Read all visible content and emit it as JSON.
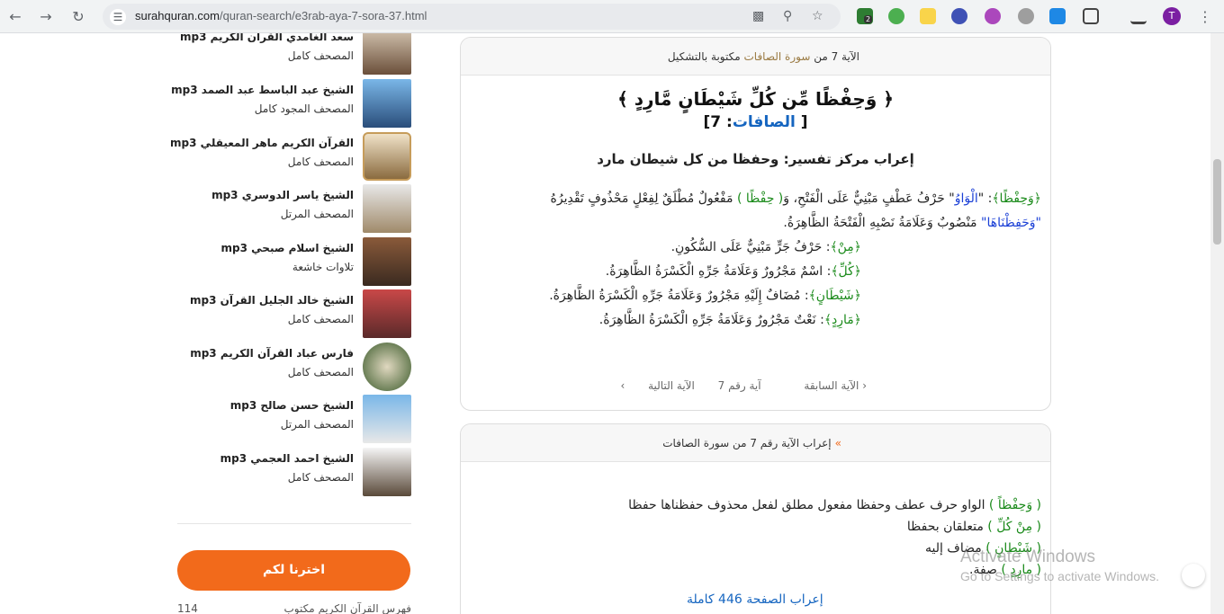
{
  "browser": {
    "url_host": "surahquran.com",
    "url_path": "/quran-search/e3rab-aya-7-sora-37.html",
    "profile_initial": "T",
    "ext_badge": "2"
  },
  "sidebar": {
    "reciters": [
      {
        "name": "سعد الغامدي القرآن الكريم mp3",
        "sub": "المصحف كامل"
      },
      {
        "name": "الشيخ عبد الباسط عبد الصمد mp3",
        "sub": "المصحف المجود كامل"
      },
      {
        "name": "القرآن الكريم ماهر المعيقلي mp3",
        "sub": "المصحف كامل"
      },
      {
        "name": "الشيخ ياسر الدوسري mp3",
        "sub": "المصحف المرتل"
      },
      {
        "name": "الشيخ اسلام صبحي mp3",
        "sub": "تلاوات خاشعة"
      },
      {
        "name": "الشيخ خالد الجليل القرآن mp3",
        "sub": "المصحف كامل"
      },
      {
        "name": "فارس عباد القرآن الكريم mp3",
        "sub": "المصحف كامل"
      },
      {
        "name": "الشيخ حسن صالح mp3",
        "sub": "المصحف المرتل"
      },
      {
        "name": "الشيخ احمد العجمي mp3",
        "sub": "المصحف كامل"
      }
    ],
    "cta_label": "اخترنا لكم",
    "footer_left": "114",
    "footer_right": "فهرس القرآن الكريم مكتوب"
  },
  "card1": {
    "head_prefix": "الآية 7 من ",
    "head_sura": "سورة الصافات",
    "head_suffix": " مكتوبة بالتشكيل",
    "verse": "﴿ وَحِفْظًا مِّن كُلِّ شَيْطَانٍ مَّارِدٍ ﴾",
    "ref_open": "[ ",
    "ref_sura": "الصافات",
    "ref_num": ": 7]",
    "section_title": "إعراب مركز تفسير: وحفظا من كل شيطان مارد",
    "lines": [
      {
        "w": "﴿وَحِفْظًا﴾",
        "t1": ": \"",
        "k": "الْوَاوُ",
        "t2": "\" حَرْفُ عَطْفٍ مَبْنِيٌّ عَلَى الْفَتْحِ، وَ",
        "w2": "( حِفْظًا )",
        "t3": " مَفْعُولٌ مُطْلَقٌ لِفِعْلٍ مَحْذُوفٍ تَقْدِيرُهُ"
      },
      {
        "k": "\"وَحَفِظْنَاهَا\"",
        "t": " مَنْصُوبٌ وَعَلَامَةُ نَصْبِهِ الْفَتْحَةُ الظَّاهِرَةُ."
      },
      {
        "w": "﴿مِنْ﴾",
        "t": ": حَرْفُ جَرٍّ مَبْنِيٌّ عَلَى السُّكُونِ."
      },
      {
        "w": "﴿كُلِّ﴾",
        "t": ": اسْمٌ مَجْرُورٌ وَعَلَامَةُ جَرِّهِ الْكَسْرَةُ الظَّاهِرَةُ."
      },
      {
        "w": "﴿شَيْطَانٍ﴾",
        "t": ": مُضَافٌ إِلَيْهِ مَجْرُورٌ وَعَلَامَةُ جَرِّهِ الْكَسْرَةُ الظَّاهِرَةُ."
      },
      {
        "w": "﴿مَارِدٍ﴾",
        "t": ": نَعْتٌ مَجْرُورٌ وَعَلَامَةُ جَرِّهِ الْكَسْرَةُ الظَّاهِرَةُ."
      }
    ],
    "pager": {
      "prev": "الآية السابقة",
      "current": "آية رقم 7",
      "next": "الآية التالية"
    }
  },
  "card2": {
    "head": "إعراب الآية رقم 7 من سورة الصافات",
    "lines": [
      {
        "w": "( وَحِفْظاً )",
        "t": " الواو حرف عطف وحفظا مفعول مطلق لفعل محذوف حفظناها حفظا"
      },
      {
        "w": "( مِنْ كُلِّ )",
        "t": " متعلقان بحفظا"
      },
      {
        "w": "( شَيْطانٍ )",
        "t": " مضاف إليه"
      },
      {
        "w": "( مارِدٍ )",
        "t": " صفة."
      }
    ],
    "page_link": "إعراب الصفحة 446 كاملة"
  },
  "watermark": {
    "line1": "Activate Windows",
    "line2": "Go to Settings to activate Windows."
  }
}
